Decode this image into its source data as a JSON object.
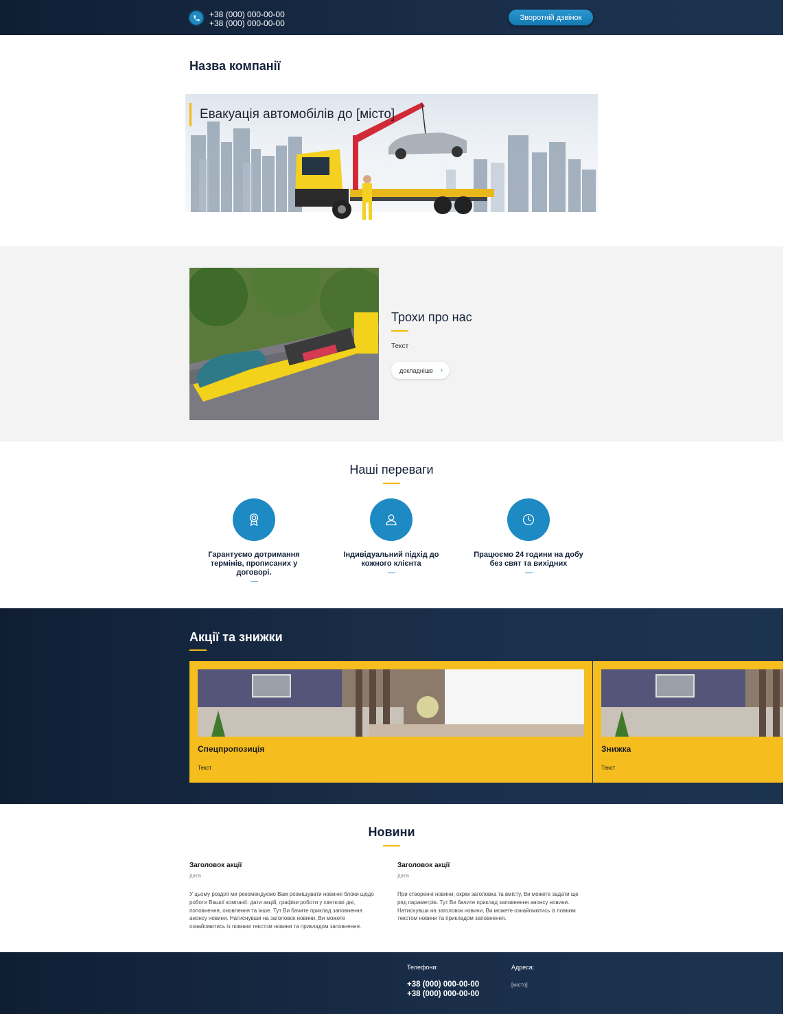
{
  "header": {
    "phone_1": "+38 (000) 000-00-00",
    "phone_2": "+38 (000) 000-00-00",
    "callback_label": "Зворотній дзвінок"
  },
  "company": {
    "name": "Назва компанії"
  },
  "hero": {
    "title": "Евакуація автомобілів до [місто]"
  },
  "about": {
    "title": "Трохи про нас",
    "text": "Текст",
    "more_label": "докладніше"
  },
  "advantages": {
    "title": "Наші переваги",
    "items": [
      {
        "icon": "award-icon",
        "text": "Гарантуємо дотримання термінів, прописаних у договорі."
      },
      {
        "icon": "user-icon",
        "text": "Індивідуальний підхід до кожного клієнта"
      },
      {
        "icon": "clock-icon",
        "text": "Працюємо 24 години на добу без свят та вихідних"
      }
    ]
  },
  "promotions": {
    "title": "Акції та знижки",
    "cards": [
      {
        "title": "Спецпропозиція",
        "text": "Текст"
      },
      {
        "title": "Знижка",
        "text": "Текст"
      }
    ]
  },
  "news": {
    "title": "Новини",
    "items": [
      {
        "title": "Заголовок акції",
        "date": "дата",
        "text": "У цьому розділі ми рекомендуємо Вам розміщувати новинні блоки щодо роботи Вашої компанії: дати акцій, графіки роботи у святкові дні, поповнення, оновлення та інше. Тут Ви бачите приклад заповнення анонсу новини. Натиснувши на заголовок новини, Ви можете ознайомитись із повним текстом новини та прикладом заповнення."
      },
      {
        "title": "Заголовок акції",
        "date": "дата",
        "text": "При створенні новини, окрім заголовка та вмісту, Ви можете задати ще ряд параметрів. Тут Ви бачите приклад заповнення анонсу новини. Натиснувши на заголовок новини, Ви можете ознайомитись із повним текстом новини та прикладом заповнення."
      }
    ]
  },
  "footer": {
    "phones_label": "Телефони:",
    "phone_1": "+38 (000) 000-00-00",
    "phone_2": "+38 (000) 000-00-00",
    "address_label": "Адреса:",
    "address": "[місто]"
  },
  "colors": {
    "accent": "#f2b90f",
    "primary": "#1d8ac4",
    "dark": "#14213a",
    "promo_card": "#f5be1e"
  }
}
